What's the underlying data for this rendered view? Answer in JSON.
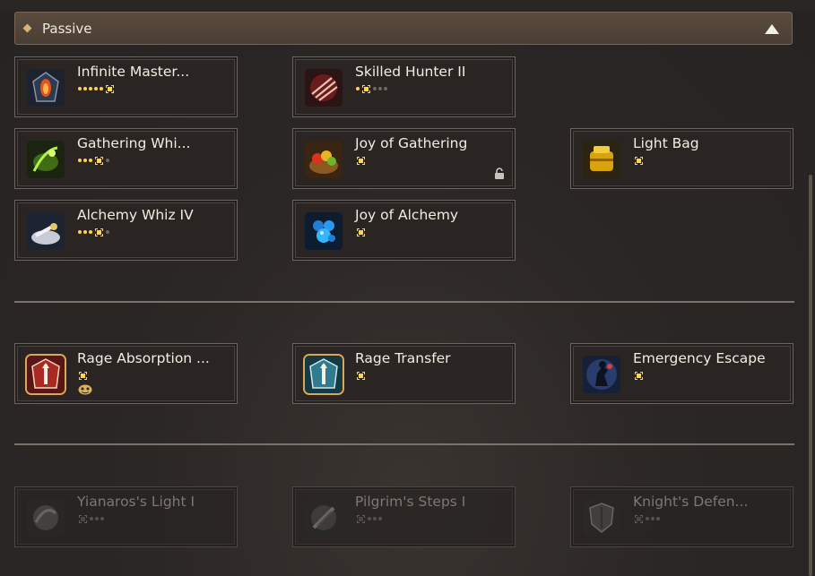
{
  "section": {
    "title": "Passive",
    "expanded": true
  },
  "groups": [
    {
      "cards": [
        {
          "name": "Infinite Master...",
          "dots": [
            "on",
            "on",
            "on",
            "on",
            "on",
            "sel"
          ],
          "icon": "orange-flame-crest-icon"
        },
        {
          "name": "Skilled Hunter II",
          "dots": [
            "on",
            "sel",
            "off",
            "off",
            "off"
          ],
          "icon": "red-claw-slash-icon"
        },
        {
          "name": "Gathering Whi...",
          "dots": [
            "on",
            "on",
            "on",
            "sel",
            "off"
          ],
          "icon": "green-leaf-gathering-icon"
        },
        {
          "name": "Joy of Gathering",
          "dots": [
            "sel"
          ],
          "icon": "fruit-basket-icon",
          "locked": true
        },
        {
          "name": "Light Bag",
          "dots": [
            "sel"
          ],
          "icon": "golden-bag-icon"
        },
        {
          "name": "Alchemy Whiz IV",
          "dots": [
            "on",
            "on",
            "on",
            "sel",
            "off"
          ],
          "icon": "alchemy-tools-icon"
        },
        {
          "name": "Joy of Alchemy",
          "dots": [
            "sel"
          ],
          "icon": "blue-crystal-cluster-icon"
        }
      ]
    },
    {
      "cards": [
        {
          "name": "Rage Absorption ...",
          "dots": [
            "sel"
          ],
          "icon": "red-rage-shield-icon",
          "subicon": "mask-icon",
          "highlighted": true
        },
        {
          "name": "Rage Transfer",
          "dots": [
            "sel"
          ],
          "icon": "teal-rage-shield-icon",
          "highlighted": true
        },
        {
          "name": "Emergency Escape",
          "dots": [
            "sel"
          ],
          "icon": "escape-silhouette-icon"
        }
      ]
    },
    {
      "cards": [
        {
          "name": "Yianaros's Light I",
          "dots": [
            "sel",
            "off",
            "off",
            "off"
          ],
          "icon": "light-orb-icon",
          "dim": true
        },
        {
          "name": "Pilgrim's Steps I",
          "dots": [
            "sel",
            "off",
            "off",
            "off"
          ],
          "icon": "pilgrim-feather-icon",
          "dim": true
        },
        {
          "name": "Knight's Defen...",
          "dots": [
            "sel",
            "off",
            "off",
            "off"
          ],
          "icon": "knight-shield-icon",
          "dim": true
        }
      ]
    }
  ],
  "colors": {
    "header_bg": "#4f4136",
    "star_on": "#ffd34a",
    "dot_off": "#6e6862",
    "highlight_border": "#d8a75a"
  }
}
